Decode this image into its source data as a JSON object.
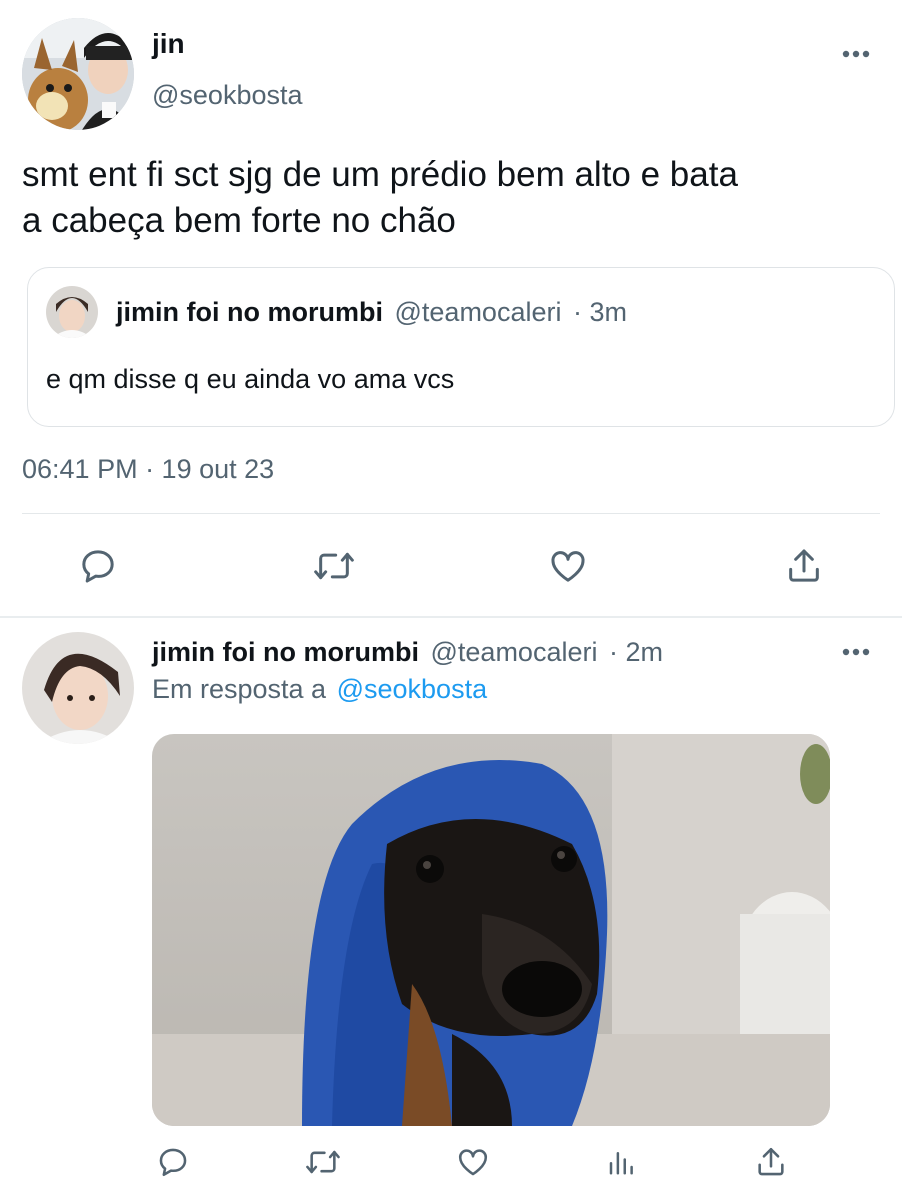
{
  "main_tweet": {
    "display_name": "jin",
    "handle": "@seokbosta",
    "text_line1": "smt ent fi sct sjg de um prédio bem alto e bata",
    "text_line2": "a cabeça bem forte no chão",
    "timestamp": "06:41 PM · 19 out 23"
  },
  "quoted_tweet": {
    "display_name": "jimin foi no morumbi",
    "handle": "@teamocaleri",
    "time": "· 3m",
    "text": "e qm disse q eu ainda vo ama vcs"
  },
  "reply_tweet": {
    "display_name": "jimin foi no morumbi",
    "handle": "@teamocaleri",
    "time": "· 2m",
    "reply_prefix": "Em resposta a",
    "reply_to": "@seokbosta"
  },
  "icons": {
    "more": "more-horizontal-icon",
    "reply": "reply-icon",
    "retweet": "retweet-icon",
    "like": "heart-icon",
    "views": "analytics-icon",
    "share": "share-icon"
  },
  "colors": {
    "text": "#0f1419",
    "secondary": "#536471",
    "link": "#1d9bf0",
    "divider": "#eff3f4"
  }
}
